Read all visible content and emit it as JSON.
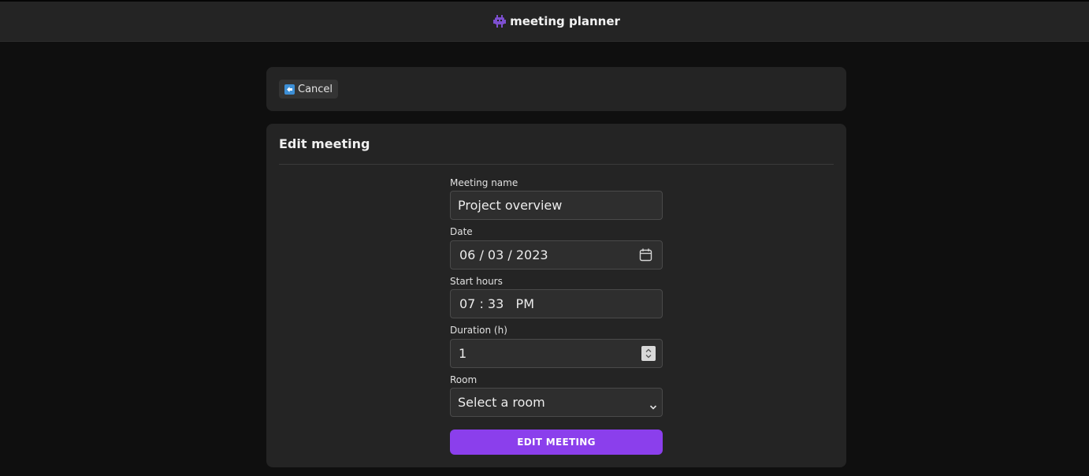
{
  "app": {
    "title": "meeting planner",
    "logo_icon": "alien-monster-icon",
    "accent_color": "#8b3fec"
  },
  "toolbar": {
    "cancel_label": "Cancel",
    "cancel_icon": "back-arrow-icon"
  },
  "form": {
    "title": "Edit meeting",
    "fields": {
      "name": {
        "label": "Meeting name",
        "value": "Project overview"
      },
      "date": {
        "label": "Date",
        "value": "06 / 03 / 2023",
        "icon": "calendar-icon"
      },
      "start": {
        "label": "Start hours",
        "value": "07 : 33   PM"
      },
      "duration": {
        "label": "Duration (h)",
        "value": "1"
      },
      "room": {
        "label": "Room",
        "selected": "Select a room"
      }
    },
    "submit_label": "EDIT MEETING"
  }
}
